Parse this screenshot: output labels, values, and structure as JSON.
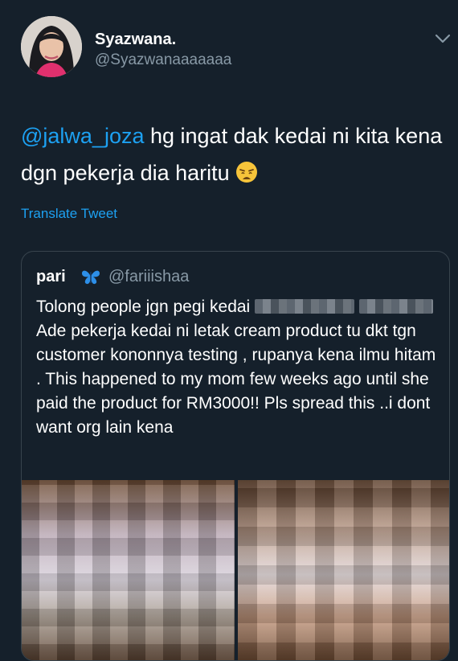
{
  "author": {
    "display_name": "Syazwana.",
    "handle": "@Syazwanaaaaaaa",
    "avatar_icon": "profile-photo"
  },
  "menu": {
    "icon": "chevron-down-icon"
  },
  "tweet": {
    "mention": "@jalwa_joza",
    "text": " hg ingat dak kedai ni kita kena dgn pekerja dia haritu ",
    "emoji": "weary-face-emoji"
  },
  "translate_label": "Translate Tweet",
  "quoted": {
    "name": "pari",
    "name_emoji": "butterfly-emoji",
    "handle": "@fariiishaa",
    "text_part1": "Tolong people jgn pegi kedai",
    "text_part2": " Ade pekerja kedai ni letak cream product tu dkt tgn customer kononnya testing , rupanya kena ilmu hitam . This happened to my mom few weeks ago until she paid the product for RM3000!! Pls spread this ..i dont want org lain kena",
    "media_count": 2
  },
  "colors": {
    "background": "#15202b",
    "link": "#1da1f2",
    "secondary_text": "#8899a6",
    "border": "#38444d"
  }
}
